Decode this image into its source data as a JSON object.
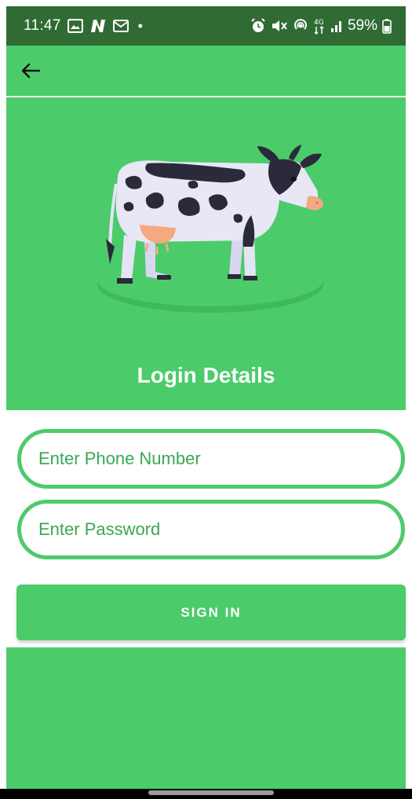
{
  "status_bar": {
    "time": "11:47",
    "battery_percent": "59%",
    "left_icons": [
      "gallery-icon",
      "n-app-icon",
      "mail-icon"
    ],
    "right_icons": [
      "alarm-icon",
      "mute-icon",
      "hotspot-icon",
      "data-4g-icon",
      "signal-icon",
      "battery-icon"
    ],
    "data_label": "4G"
  },
  "toolbar": {
    "back_icon": "arrow-left-icon"
  },
  "hero": {
    "title": "Login Details",
    "illustration": "cow-illustration"
  },
  "form": {
    "phone_placeholder": "Enter Phone Number",
    "password_placeholder": "Enter Password",
    "signin_label": "SIGN IN"
  },
  "colors": {
    "primary_green": "#4ccb6b",
    "status_bar_green": "#2f6b33",
    "placeholder_green": "#3aa753",
    "white": "#ffffff"
  }
}
